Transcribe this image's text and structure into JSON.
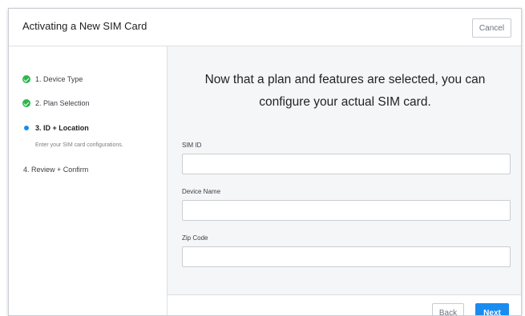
{
  "dialog": {
    "title": "Activating a New SIM Card",
    "cancel_label": "Cancel"
  },
  "steps": [
    {
      "label": "1. Device Type",
      "status": "complete"
    },
    {
      "label": "2. Plan Selection",
      "status": "complete"
    },
    {
      "label": "3. ID + Location",
      "status": "active",
      "sublabel": "Enter your SIM card configurations."
    },
    {
      "label": "4. Review + Confirm",
      "status": "pending"
    }
  ],
  "main": {
    "headline_line1": "Now that a plan and features are selected, you can",
    "headline_line2": "configure your actual SIM card.",
    "fields": [
      {
        "label": "SIM ID",
        "value": "",
        "placeholder": ""
      },
      {
        "label": "Device Name",
        "value": "",
        "placeholder": ""
      },
      {
        "label": "Zip Code",
        "value": "",
        "placeholder": ""
      }
    ]
  },
  "footer": {
    "back_label": "Back",
    "next_label": "Next"
  },
  "colors": {
    "accent": "#1a8cf0",
    "complete": "#2db84d"
  },
  "icons": {
    "complete": "check-circle-icon",
    "active": "dot-icon"
  }
}
